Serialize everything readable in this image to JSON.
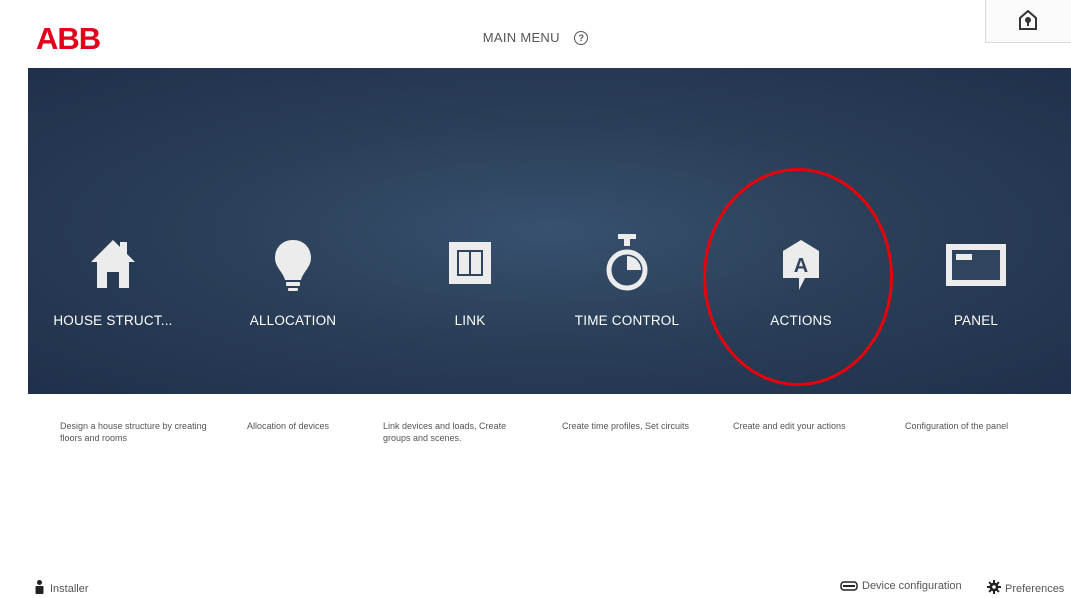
{
  "header": {
    "logo": "ABB",
    "title": "MAIN MENU",
    "help_glyph": "?",
    "home_icon": "home-lock-icon"
  },
  "tiles": [
    {
      "label": "HOUSE STRUCT...",
      "icon": "house-icon",
      "description": "Design a house structure by creating floors and rooms"
    },
    {
      "label": "ALLOCATION",
      "icon": "bulb-icon",
      "description": "Allocation of devices"
    },
    {
      "label": "LINK",
      "icon": "link-icon",
      "description": "Link devices and loads, Create groups and scenes."
    },
    {
      "label": "TIME CONTROL",
      "icon": "stopwatch-icon",
      "description": "Create time profiles, Set circuits"
    },
    {
      "label": "ACTIONS",
      "icon": "actions-icon",
      "description": "Create and edit your actions"
    },
    {
      "label": "PANEL",
      "icon": "panel-icon",
      "description": "Configuration of the panel"
    }
  ],
  "actions_glyph": "A",
  "footer": {
    "user": "Installer",
    "device_configuration": "Device configuration",
    "preferences": "Preferences"
  },
  "colors": {
    "brand": "#e2001a",
    "panel": "#2b3f58",
    "highlight": "#e8000b"
  }
}
